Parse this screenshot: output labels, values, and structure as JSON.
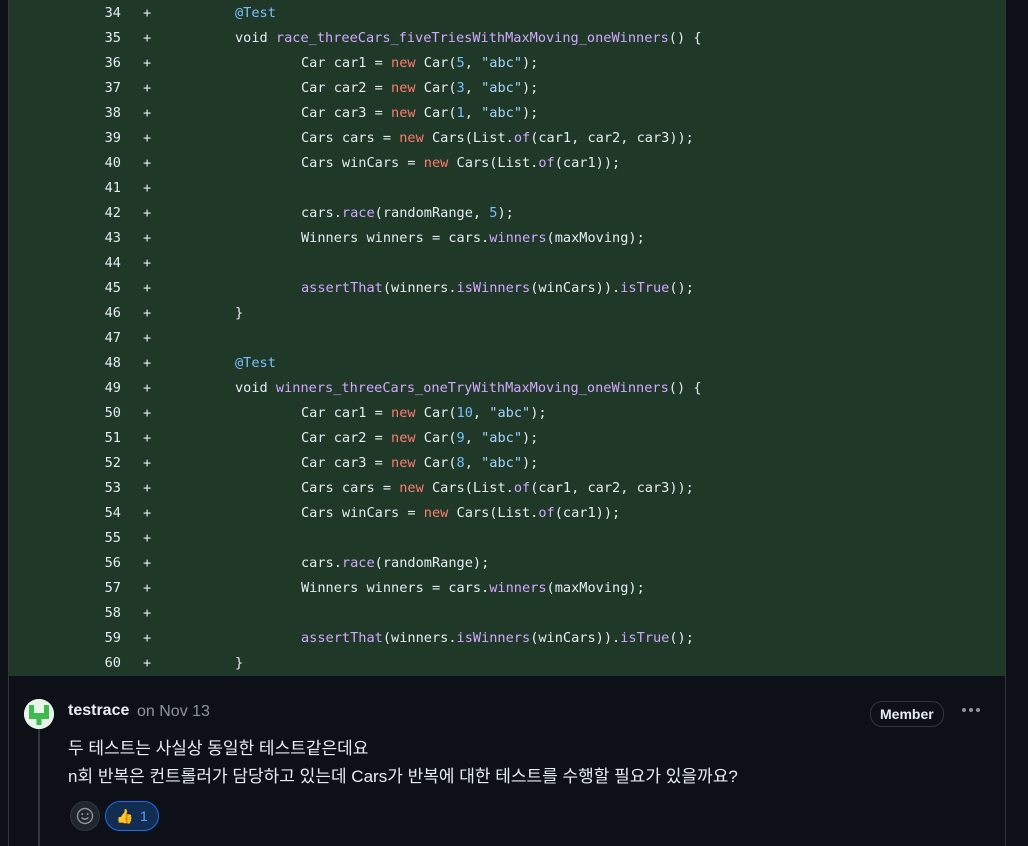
{
  "diff": {
    "lines": [
      {
        "n": "34",
        "marker": "+",
        "indent": 1,
        "tokens": [
          {
            "t": "@Test",
            "c": "an"
          }
        ]
      },
      {
        "n": "35",
        "marker": "+",
        "indent": 1,
        "tokens": [
          {
            "t": "void ",
            "c": "ty"
          },
          {
            "t": "race_threeCars_fiveTriesWithMaxMoving_oneWinners",
            "c": "fn"
          },
          {
            "t": "() {",
            "c": "ty"
          }
        ]
      },
      {
        "n": "36",
        "marker": "+",
        "indent": 2,
        "tokens": [
          {
            "t": "Car car1 = ",
            "c": "ty"
          },
          {
            "t": "new",
            "c": "kw"
          },
          {
            "t": " Car(",
            "c": "ty"
          },
          {
            "t": "5",
            "c": "num"
          },
          {
            "t": ", ",
            "c": "ty"
          },
          {
            "t": "\"abc\"",
            "c": "str"
          },
          {
            "t": ");",
            "c": "ty"
          }
        ]
      },
      {
        "n": "37",
        "marker": "+",
        "indent": 2,
        "tokens": [
          {
            "t": "Car car2 = ",
            "c": "ty"
          },
          {
            "t": "new",
            "c": "kw"
          },
          {
            "t": " Car(",
            "c": "ty"
          },
          {
            "t": "3",
            "c": "num"
          },
          {
            "t": ", ",
            "c": "ty"
          },
          {
            "t": "\"abc\"",
            "c": "str"
          },
          {
            "t": ");",
            "c": "ty"
          }
        ]
      },
      {
        "n": "38",
        "marker": "+",
        "indent": 2,
        "tokens": [
          {
            "t": "Car car3 = ",
            "c": "ty"
          },
          {
            "t": "new",
            "c": "kw"
          },
          {
            "t": " Car(",
            "c": "ty"
          },
          {
            "t": "1",
            "c": "num"
          },
          {
            "t": ", ",
            "c": "ty"
          },
          {
            "t": "\"abc\"",
            "c": "str"
          },
          {
            "t": ");",
            "c": "ty"
          }
        ]
      },
      {
        "n": "39",
        "marker": "+",
        "indent": 2,
        "tokens": [
          {
            "t": "Cars cars = ",
            "c": "ty"
          },
          {
            "t": "new",
            "c": "kw"
          },
          {
            "t": " Cars(List.",
            "c": "ty"
          },
          {
            "t": "of",
            "c": "fn"
          },
          {
            "t": "(car1, car2, car3));",
            "c": "ty"
          }
        ]
      },
      {
        "n": "40",
        "marker": "+",
        "indent": 2,
        "tokens": [
          {
            "t": "Cars winCars = ",
            "c": "ty"
          },
          {
            "t": "new",
            "c": "kw"
          },
          {
            "t": " Cars(List.",
            "c": "ty"
          },
          {
            "t": "of",
            "c": "fn"
          },
          {
            "t": "(car1));",
            "c": "ty"
          }
        ]
      },
      {
        "n": "41",
        "marker": "+",
        "indent": 0,
        "tokens": []
      },
      {
        "n": "42",
        "marker": "+",
        "indent": 2,
        "tokens": [
          {
            "t": "cars.",
            "c": "ty"
          },
          {
            "t": "race",
            "c": "fn"
          },
          {
            "t": "(randomRange, ",
            "c": "ty"
          },
          {
            "t": "5",
            "c": "num"
          },
          {
            "t": ");",
            "c": "ty"
          }
        ]
      },
      {
        "n": "43",
        "marker": "+",
        "indent": 2,
        "tokens": [
          {
            "t": "Winners winners = cars.",
            "c": "ty"
          },
          {
            "t": "winners",
            "c": "fn"
          },
          {
            "t": "(maxMoving);",
            "c": "ty"
          }
        ]
      },
      {
        "n": "44",
        "marker": "+",
        "indent": 0,
        "tokens": []
      },
      {
        "n": "45",
        "marker": "+",
        "indent": 2,
        "tokens": [
          {
            "t": "assertThat",
            "c": "fn"
          },
          {
            "t": "(winners.",
            "c": "ty"
          },
          {
            "t": "isWinners",
            "c": "fn"
          },
          {
            "t": "(winCars)).",
            "c": "ty"
          },
          {
            "t": "isTrue",
            "c": "fn"
          },
          {
            "t": "();",
            "c": "ty"
          }
        ]
      },
      {
        "n": "46",
        "marker": "+",
        "indent": 1,
        "tokens": [
          {
            "t": "}",
            "c": "ty"
          }
        ]
      },
      {
        "n": "47",
        "marker": "+",
        "indent": 0,
        "tokens": []
      },
      {
        "n": "48",
        "marker": "+",
        "indent": 1,
        "tokens": [
          {
            "t": "@Test",
            "c": "an"
          }
        ]
      },
      {
        "n": "49",
        "marker": "+",
        "indent": 1,
        "tokens": [
          {
            "t": "void ",
            "c": "ty"
          },
          {
            "t": "winners_threeCars_oneTryWithMaxMoving_oneWinners",
            "c": "fn"
          },
          {
            "t": "() {",
            "c": "ty"
          }
        ]
      },
      {
        "n": "50",
        "marker": "+",
        "indent": 2,
        "tokens": [
          {
            "t": "Car car1 = ",
            "c": "ty"
          },
          {
            "t": "new",
            "c": "kw"
          },
          {
            "t": " Car(",
            "c": "ty"
          },
          {
            "t": "10",
            "c": "num"
          },
          {
            "t": ", ",
            "c": "ty"
          },
          {
            "t": "\"abc\"",
            "c": "str"
          },
          {
            "t": ");",
            "c": "ty"
          }
        ]
      },
      {
        "n": "51",
        "marker": "+",
        "indent": 2,
        "tokens": [
          {
            "t": "Car car2 = ",
            "c": "ty"
          },
          {
            "t": "new",
            "c": "kw"
          },
          {
            "t": " Car(",
            "c": "ty"
          },
          {
            "t": "9",
            "c": "num"
          },
          {
            "t": ", ",
            "c": "ty"
          },
          {
            "t": "\"abc\"",
            "c": "str"
          },
          {
            "t": ");",
            "c": "ty"
          }
        ]
      },
      {
        "n": "52",
        "marker": "+",
        "indent": 2,
        "tokens": [
          {
            "t": "Car car3 = ",
            "c": "ty"
          },
          {
            "t": "new",
            "c": "kw"
          },
          {
            "t": " Car(",
            "c": "ty"
          },
          {
            "t": "8",
            "c": "num"
          },
          {
            "t": ", ",
            "c": "ty"
          },
          {
            "t": "\"abc\"",
            "c": "str"
          },
          {
            "t": ");",
            "c": "ty"
          }
        ]
      },
      {
        "n": "53",
        "marker": "+",
        "indent": 2,
        "tokens": [
          {
            "t": "Cars cars = ",
            "c": "ty"
          },
          {
            "t": "new",
            "c": "kw"
          },
          {
            "t": " Cars(List.",
            "c": "ty"
          },
          {
            "t": "of",
            "c": "fn"
          },
          {
            "t": "(car1, car2, car3));",
            "c": "ty"
          }
        ]
      },
      {
        "n": "54",
        "marker": "+",
        "indent": 2,
        "tokens": [
          {
            "t": "Cars winCars = ",
            "c": "ty"
          },
          {
            "t": "new",
            "c": "kw"
          },
          {
            "t": " Cars(List.",
            "c": "ty"
          },
          {
            "t": "of",
            "c": "fn"
          },
          {
            "t": "(car1));",
            "c": "ty"
          }
        ]
      },
      {
        "n": "55",
        "marker": "+",
        "indent": 0,
        "tokens": []
      },
      {
        "n": "56",
        "marker": "+",
        "indent": 2,
        "tokens": [
          {
            "t": "cars.",
            "c": "ty"
          },
          {
            "t": "race",
            "c": "fn"
          },
          {
            "t": "(randomRange);",
            "c": "ty"
          }
        ]
      },
      {
        "n": "57",
        "marker": "+",
        "indent": 2,
        "tokens": [
          {
            "t": "Winners winners = cars.",
            "c": "ty"
          },
          {
            "t": "winners",
            "c": "fn"
          },
          {
            "t": "(maxMoving);",
            "c": "ty"
          }
        ]
      },
      {
        "n": "58",
        "marker": "+",
        "indent": 0,
        "tokens": []
      },
      {
        "n": "59",
        "marker": "+",
        "indent": 2,
        "tokens": [
          {
            "t": "assertThat",
            "c": "fn"
          },
          {
            "t": "(winners.",
            "c": "ty"
          },
          {
            "t": "isWinners",
            "c": "fn"
          },
          {
            "t": "(winCars)).",
            "c": "ty"
          },
          {
            "t": "isTrue",
            "c": "fn"
          },
          {
            "t": "();",
            "c": "ty"
          }
        ]
      },
      {
        "n": "60",
        "marker": "+",
        "indent": 1,
        "tokens": [
          {
            "t": "}",
            "c": "ty"
          }
        ]
      }
    ]
  },
  "comment": {
    "author": "testrace",
    "date": "on Nov 13",
    "badge": "Member",
    "more_label": "···",
    "body": [
      "두 테스트는 사실상 동일한 테스트같은데요",
      "n회 반복은 컨트롤러가 담당하고 있는데 Cars가 반복에 대한 테스트를 수행할 필요가 있을까요?"
    ],
    "add_reaction_icon": "smiley-icon",
    "reaction": {
      "emoji": "👍",
      "count": "1"
    }
  },
  "colors": {
    "diff_bg": "#1f3828",
    "page_bg": "#0d1117",
    "keyword": "#ff7b72",
    "annotation": "#79c0ff",
    "function": "#d2a8ff",
    "string": "#a5d6ff"
  }
}
